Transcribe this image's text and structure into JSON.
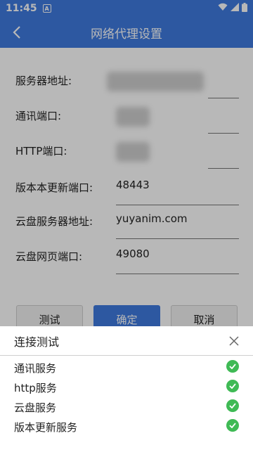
{
  "status_bar": {
    "time": "11:45",
    "notification_badge": "A"
  },
  "app_bar": {
    "title": "网络代理设置"
  },
  "form": {
    "server_address_label": "服务器地址:",
    "comm_port_label": "通讯端口:",
    "http_port_label": "HTTP端口:",
    "update_port_label": "版本本更新端口:",
    "update_port_value": "48443",
    "cloud_server_label": "云盘服务器地址:",
    "cloud_server_value": "yuyanim.com",
    "cloud_web_port_label": "云盘网页端口:",
    "cloud_web_port_value": "49080"
  },
  "buttons": {
    "test": "测试",
    "ok": "确定",
    "cancel": "取消"
  },
  "dialog": {
    "title": "连接测试",
    "services": [
      {
        "name": "通讯服务"
      },
      {
        "name": "http服务"
      },
      {
        "name": "云盘服务"
      },
      {
        "name": "版本更新服务"
      }
    ]
  },
  "colors": {
    "primary": "#3f7be0",
    "success": "#3fba55"
  }
}
